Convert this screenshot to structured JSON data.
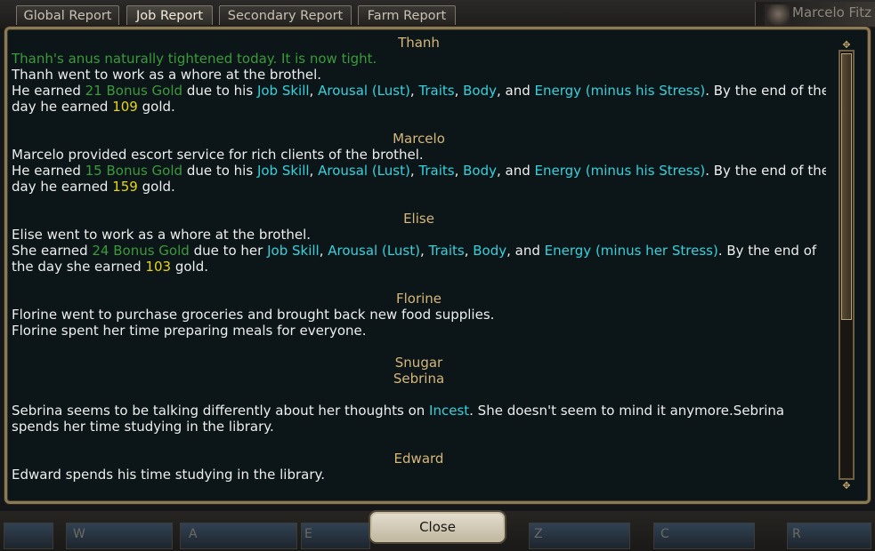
{
  "tabs": [
    {
      "label": "Global Report"
    },
    {
      "label": "Job Report"
    },
    {
      "label": "Secondary Report"
    },
    {
      "label": "Farm Report"
    }
  ],
  "active_tab": "Job Report",
  "character_name": "Marcelo Fitz",
  "report": [
    {
      "name": "Thanh",
      "lines": [
        [
          {
            "t": "Thanh's anus naturally tightened today. It is now tight.",
            "c": "g"
          }
        ],
        [
          {
            "t": "Thanh went to work as a whore at the brothel."
          }
        ],
        [
          {
            "t": "He earned "
          },
          {
            "t": "21 Bonus Gold",
            "c": "g"
          },
          {
            "t": " due to his "
          },
          {
            "t": "Job Skill",
            "c": "c"
          },
          {
            "t": ", "
          },
          {
            "t": "Arousal (Lust)",
            "c": "c"
          },
          {
            "t": ", "
          },
          {
            "t": "Traits",
            "c": "c"
          },
          {
            "t": ", "
          },
          {
            "t": "Body",
            "c": "c"
          },
          {
            "t": ", and "
          },
          {
            "t": "Energy (minus his Stress)",
            "c": "c"
          },
          {
            "t": ". By the end of the"
          }
        ],
        [
          {
            "t": "day he earned "
          },
          {
            "t": "109",
            "c": "y"
          },
          {
            "t": " gold."
          }
        ]
      ]
    },
    {
      "name": "Marcelo",
      "lines": [
        [
          {
            "t": "Marcelo provided escort service for rich clients of the brothel."
          }
        ],
        [
          {
            "t": "He earned "
          },
          {
            "t": "15 Bonus Gold",
            "c": "g"
          },
          {
            "t": " due to his "
          },
          {
            "t": "Job Skill",
            "c": "c"
          },
          {
            "t": ", "
          },
          {
            "t": "Arousal (Lust)",
            "c": "c"
          },
          {
            "t": ", "
          },
          {
            "t": "Traits",
            "c": "c"
          },
          {
            "t": ", "
          },
          {
            "t": "Body",
            "c": "c"
          },
          {
            "t": ", and "
          },
          {
            "t": "Energy (minus his Stress)",
            "c": "c"
          },
          {
            "t": ". By the end of the"
          }
        ],
        [
          {
            "t": "day he earned "
          },
          {
            "t": "159",
            "c": "y"
          },
          {
            "t": " gold."
          }
        ]
      ]
    },
    {
      "name": "Elise",
      "lines": [
        [
          {
            "t": "Elise went to work as a whore at the brothel."
          }
        ],
        [
          {
            "t": "She earned "
          },
          {
            "t": "24 Bonus Gold",
            "c": "g"
          },
          {
            "t": " due to her "
          },
          {
            "t": "Job Skill",
            "c": "c"
          },
          {
            "t": ", "
          },
          {
            "t": "Arousal (Lust)",
            "c": "c"
          },
          {
            "t": ", "
          },
          {
            "t": "Traits",
            "c": "c"
          },
          {
            "t": ", "
          },
          {
            "t": "Body",
            "c": "c"
          },
          {
            "t": ", and "
          },
          {
            "t": "Energy (minus her Stress)",
            "c": "c"
          },
          {
            "t": ". By the end of"
          }
        ],
        [
          {
            "t": "the day she earned "
          },
          {
            "t": "103",
            "c": "y"
          },
          {
            "t": " gold."
          }
        ]
      ]
    },
    {
      "name": "Florine",
      "lines": [
        [
          {
            "t": "Florine went to purchase groceries and brought back new food supplies."
          }
        ],
        [
          {
            "t": "Florine spent her time preparing meals for everyone."
          }
        ]
      ]
    },
    {
      "name": "Snugar",
      "lines": []
    },
    {
      "name": "Sebrina",
      "lines": [
        [],
        [
          {
            "t": "Sebrina seems to be talking differently about her thoughts on "
          },
          {
            "t": "Incest",
            "c": "c"
          },
          {
            "t": ". She doesn't seem to mind it anymore.Sebrina"
          }
        ],
        [
          {
            "t": "spends her time studying in the library."
          }
        ]
      ]
    },
    {
      "name": "Edward",
      "lines": [
        [
          {
            "t": "Edward spends his time studying in the library."
          }
        ]
      ]
    }
  ],
  "scroll_icons": {
    "up": "scroll-up-ornament-icon",
    "down": "scroll-down-ornament-icon"
  },
  "hotbar_keys": [
    "W",
    "A",
    "E",
    "Z",
    "C",
    "R"
  ],
  "close_label": "Close",
  "colors": {
    "name": "#d6b67a",
    "bonus": "#3c9a3c",
    "keyword": "#36d1dc",
    "gold": "#e6d51a",
    "text": "#eeeeee"
  }
}
